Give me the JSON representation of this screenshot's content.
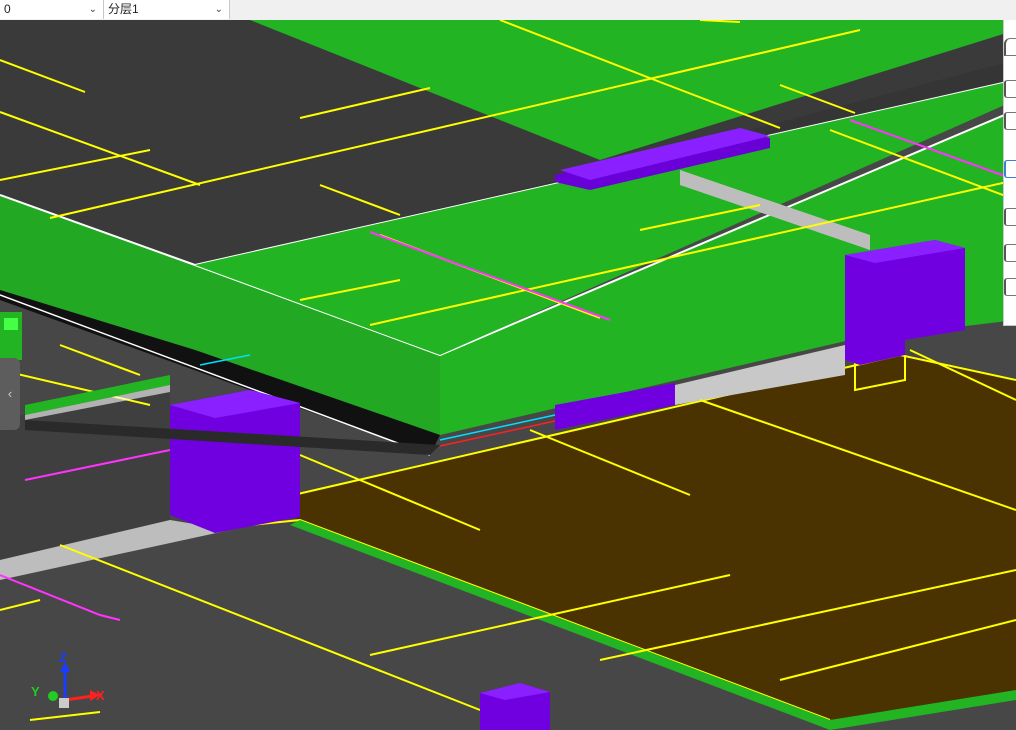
{
  "toolbar": {
    "view_combo_value": "0",
    "floor_combo_value": "分层1",
    "combo_arrow": "⌄"
  },
  "side_toolbar": {
    "buttons": [
      "view-icon",
      "select-icon",
      "copy-icon",
      "section-icon",
      "measure-icon",
      "filter-icon",
      "layer-icon"
    ]
  },
  "collapse_tab": {
    "glyph": "‹"
  },
  "axes": {
    "z": "Z",
    "y": "Y",
    "x": "X"
  },
  "colors": {
    "slab": "#3c3c3c",
    "beam_green": "#22b422",
    "column_purple": "#7000e0",
    "floor_brown": "#4a3300",
    "rebar_yellow": "#ffff00",
    "edge_magenta": "#ff33ff"
  }
}
